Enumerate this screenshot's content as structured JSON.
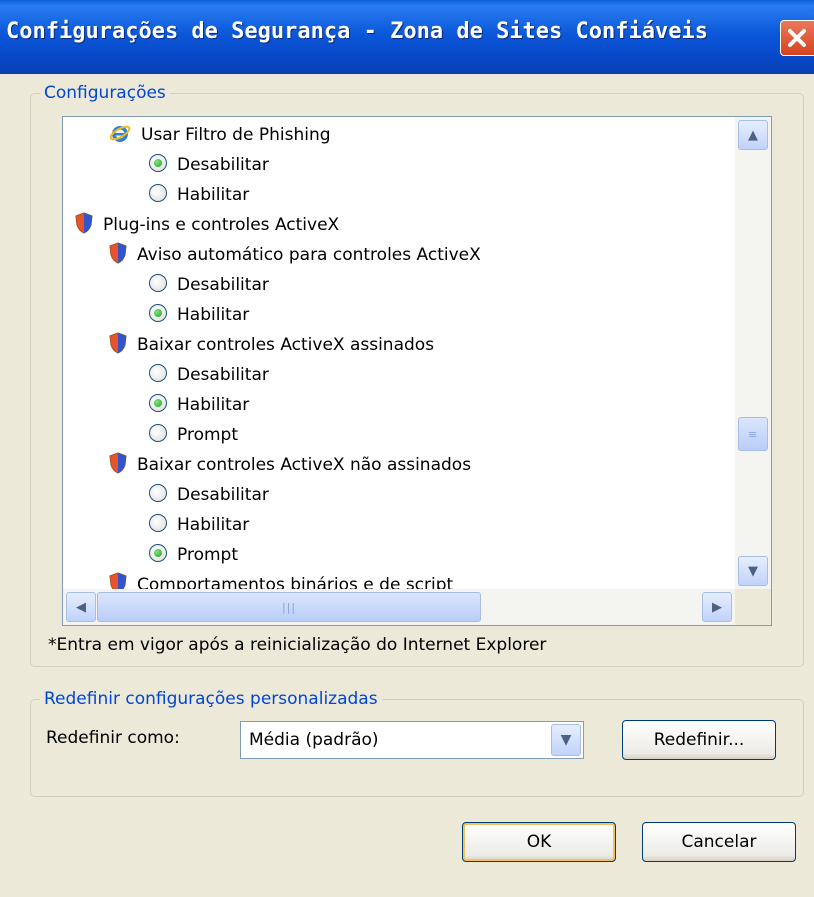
{
  "window": {
    "title": "Configurações de Segurança - Zona de Sites Confiáveis"
  },
  "settings_group": {
    "legend": "Configurações",
    "tree": [
      {
        "type": "category",
        "icon": "ie-icon",
        "label": "Usar Filtro de Phishing"
      },
      {
        "type": "option",
        "label": "Desabilitar",
        "selected": true
      },
      {
        "type": "option",
        "label": "Habilitar",
        "selected": false
      },
      {
        "type": "group",
        "icon": "shield-icon",
        "label": "Plug-ins e controles ActiveX"
      },
      {
        "type": "category",
        "icon": "shield-icon",
        "label": "Aviso automático para controles ActiveX"
      },
      {
        "type": "option",
        "label": "Desabilitar",
        "selected": false
      },
      {
        "type": "option",
        "label": "Habilitar",
        "selected": true
      },
      {
        "type": "category",
        "icon": "shield-icon",
        "label": "Baixar controles ActiveX assinados"
      },
      {
        "type": "option",
        "label": "Desabilitar",
        "selected": false
      },
      {
        "type": "option",
        "label": "Habilitar",
        "selected": true
      },
      {
        "type": "option",
        "label": "Prompt",
        "selected": false
      },
      {
        "type": "category",
        "icon": "shield-icon",
        "label": "Baixar controles ActiveX não assinados"
      },
      {
        "type": "option",
        "label": "Desabilitar",
        "selected": false
      },
      {
        "type": "option",
        "label": "Habilitar",
        "selected": false
      },
      {
        "type": "option",
        "label": "Prompt",
        "selected": true
      },
      {
        "type": "category",
        "icon": "shield-icon",
        "label": "Comportamentos binários e de script"
      }
    ],
    "note": "*Entra em vigor após a reinicialização do Internet Explorer"
  },
  "reset_group": {
    "legend": "Redefinir configurações personalizadas",
    "reset_to_label": "Redefinir como:",
    "reset_to_value": "Média (padrão)",
    "reset_button": "Redefinir..."
  },
  "buttons": {
    "ok": "OK",
    "cancel": "Cancelar"
  },
  "colors": {
    "title_bar": "#0b58d9",
    "legend_text": "#0046d5",
    "dialog_bg": "#ece9d8",
    "close_button": "#d5421f"
  }
}
